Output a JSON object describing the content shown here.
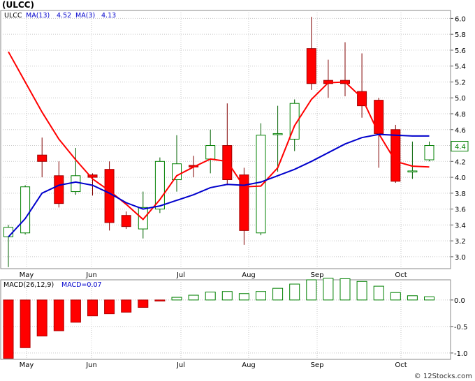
{
  "title": "(ULCC)",
  "watermark": "© 12Stocks.com",
  "chart_data": [
    {
      "type": "candlestick",
      "legend": {
        "symbol": "ULCC",
        "ma1_label": "MA(13)",
        "ma1_value": "4.52",
        "ma2_label": "MA(3)",
        "ma2_value": "4.13"
      },
      "last_price_label": "4.4",
      "x_tick_labels": [
        "May",
        "Jun",
        "Jul",
        "Aug",
        "Sep",
        "Oct"
      ],
      "y_tick_labels": [
        "3.0",
        "3.2",
        "3.4",
        "3.6",
        "3.8",
        "4.0",
        "4.2",
        "4.4",
        "4.6",
        "4.8",
        "5.0",
        "5.2",
        "5.4",
        "5.6",
        "5.8",
        "6.0"
      ],
      "ylim": [
        2.85,
        6.1
      ],
      "colors": {
        "up": "#008000",
        "down": "#ff0000",
        "ma13": "#ff0000",
        "ma3": "#0000cc"
      },
      "candles": [
        {
          "date": "Apr 28",
          "open": 3.25,
          "high": 3.4,
          "low": 2.87,
          "close": 3.37
        },
        {
          "date": "May 5",
          "open": 3.3,
          "high": 3.9,
          "low": 3.28,
          "close": 3.88
        },
        {
          "date": "May 12",
          "open": 4.28,
          "high": 4.5,
          "low": 4.0,
          "close": 4.2
        },
        {
          "date": "May 19",
          "open": 4.02,
          "high": 4.2,
          "low": 3.62,
          "close": 3.67
        },
        {
          "date": "May 26",
          "open": 3.82,
          "high": 4.37,
          "low": 3.78,
          "close": 4.02
        },
        {
          "date": "Jun 2",
          "open": 4.03,
          "high": 4.05,
          "low": 3.77,
          "close": 4.0
        },
        {
          "date": "Jun 9",
          "open": 4.1,
          "high": 4.2,
          "low": 3.33,
          "close": 3.43
        },
        {
          "date": "Jun 16",
          "open": 3.52,
          "high": 3.57,
          "low": 3.35,
          "close": 3.38
        },
        {
          "date": "Jun 23",
          "open": 3.35,
          "high": 3.82,
          "low": 3.23,
          "close": 3.62
        },
        {
          "date": "Jun 30",
          "open": 3.6,
          "high": 4.25,
          "low": 3.55,
          "close": 4.2
        },
        {
          "date": "Jul 7",
          "open": 3.97,
          "high": 4.53,
          "low": 3.82,
          "close": 4.17
        },
        {
          "date": "Jul 14",
          "open": 4.15,
          "high": 4.27,
          "low": 4.0,
          "close": 4.13
        },
        {
          "date": "Jul 21",
          "open": 4.23,
          "high": 4.6,
          "low": 4.05,
          "close": 4.4
        },
        {
          "date": "Jul 28",
          "open": 4.4,
          "high": 4.93,
          "low": 3.9,
          "close": 3.97
        },
        {
          "date": "Aug 4",
          "open": 4.03,
          "high": 4.12,
          "low": 3.15,
          "close": 3.33
        },
        {
          "date": "Aug 11",
          "open": 3.3,
          "high": 4.68,
          "low": 3.27,
          "close": 4.53
        },
        {
          "date": "Aug 18",
          "open": 4.55,
          "high": 4.9,
          "low": 4.07,
          "close": 4.55
        },
        {
          "date": "Aug 25",
          "open": 4.48,
          "high": 4.98,
          "low": 4.33,
          "close": 4.93
        },
        {
          "date": "Sep 1",
          "open": 5.62,
          "high": 6.02,
          "low": 5.1,
          "close": 5.18
        },
        {
          "date": "Sep 8",
          "open": 5.22,
          "high": 5.48,
          "low": 5.0,
          "close": 5.18
        },
        {
          "date": "Sep 15",
          "open": 5.22,
          "high": 5.7,
          "low": 5.02,
          "close": 5.18
        },
        {
          "date": "Sep 22",
          "open": 5.08,
          "high": 5.56,
          "low": 4.75,
          "close": 4.9
        },
        {
          "date": "Sep 29",
          "open": 4.97,
          "high": 5.0,
          "low": 4.12,
          "close": 4.55
        },
        {
          "date": "Oct 6",
          "open": 4.6,
          "high": 4.66,
          "low": 3.93,
          "close": 3.95
        },
        {
          "date": "Oct 13",
          "open": 4.08,
          "high": 4.45,
          "low": 3.98,
          "close": 4.08
        },
        {
          "date": "Oct 20",
          "open": 4.22,
          "high": 4.45,
          "low": 4.2,
          "close": 4.4
        }
      ],
      "ma13": [
        {
          "i": 0,
          "v": 5.58
        },
        {
          "i": 1,
          "v": 5.2
        },
        {
          "i": 2,
          "v": 4.82
        },
        {
          "i": 3,
          "v": 4.48
        },
        {
          "i": 4,
          "v": 4.22
        },
        {
          "i": 5,
          "v": 3.98
        },
        {
          "i": 6,
          "v": 3.83
        },
        {
          "i": 7,
          "v": 3.66
        },
        {
          "i": 8,
          "v": 3.47
        },
        {
          "i": 9,
          "v": 3.72
        },
        {
          "i": 10,
          "v": 4.02
        },
        {
          "i": 11,
          "v": 4.13
        },
        {
          "i": 12,
          "v": 4.23
        },
        {
          "i": 13,
          "v": 4.2
        },
        {
          "i": 14,
          "v": 3.88
        },
        {
          "i": 15,
          "v": 3.89
        },
        {
          "i": 16,
          "v": 4.12
        },
        {
          "i": 17,
          "v": 4.65
        },
        {
          "i": 18,
          "v": 4.98
        },
        {
          "i": 19,
          "v": 5.19
        },
        {
          "i": 20,
          "v": 5.2
        },
        {
          "i": 21,
          "v": 5.0
        },
        {
          "i": 22,
          "v": 4.55
        },
        {
          "i": 23,
          "v": 4.2
        },
        {
          "i": 24,
          "v": 4.14
        },
        {
          "i": 25,
          "v": 4.13
        }
      ],
      "ma3": [
        {
          "i": 0,
          "v": 3.25
        },
        {
          "i": 1,
          "v": 3.48
        },
        {
          "i": 2,
          "v": 3.8
        },
        {
          "i": 3,
          "v": 3.9
        },
        {
          "i": 4,
          "v": 3.94
        },
        {
          "i": 5,
          "v": 3.9
        },
        {
          "i": 6,
          "v": 3.8
        },
        {
          "i": 7,
          "v": 3.68
        },
        {
          "i": 8,
          "v": 3.6
        },
        {
          "i": 9,
          "v": 3.64
        },
        {
          "i": 10,
          "v": 3.71
        },
        {
          "i": 11,
          "v": 3.78
        },
        {
          "i": 12,
          "v": 3.87
        },
        {
          "i": 13,
          "v": 3.91
        },
        {
          "i": 14,
          "v": 3.9
        },
        {
          "i": 15,
          "v": 3.94
        },
        {
          "i": 16,
          "v": 4.02
        },
        {
          "i": 17,
          "v": 4.1
        },
        {
          "i": 18,
          "v": 4.2
        },
        {
          "i": 19,
          "v": 4.31
        },
        {
          "i": 20,
          "v": 4.42
        },
        {
          "i": 21,
          "v": 4.5
        },
        {
          "i": 22,
          "v": 4.54
        },
        {
          "i": 23,
          "v": 4.53
        },
        {
          "i": 24,
          "v": 4.52
        },
        {
          "i": 25,
          "v": 4.52
        }
      ]
    },
    {
      "type": "bar",
      "legend": {
        "label": "MACD(26,12,9)",
        "value_label": "MACD=0.07"
      },
      "x_tick_labels": [
        "May",
        "Jun",
        "Jul",
        "Aug",
        "Sep",
        "Oct"
      ],
      "y_tick_labels": [
        "0.0",
        "-0.5",
        "-1.0"
      ],
      "ylim": [
        -1.12,
        0.38
      ],
      "colors": {
        "negative": "#ff0000",
        "positive": "#008000"
      },
      "values": [
        -1.1,
        -0.9,
        -0.68,
        -0.58,
        -0.42,
        -0.3,
        -0.26,
        -0.23,
        -0.14,
        -0.01,
        0.05,
        0.09,
        0.15,
        0.16,
        0.12,
        0.16,
        0.22,
        0.3,
        0.38,
        0.41,
        0.4,
        0.35,
        0.26,
        0.14,
        0.08,
        0.06
      ]
    }
  ]
}
